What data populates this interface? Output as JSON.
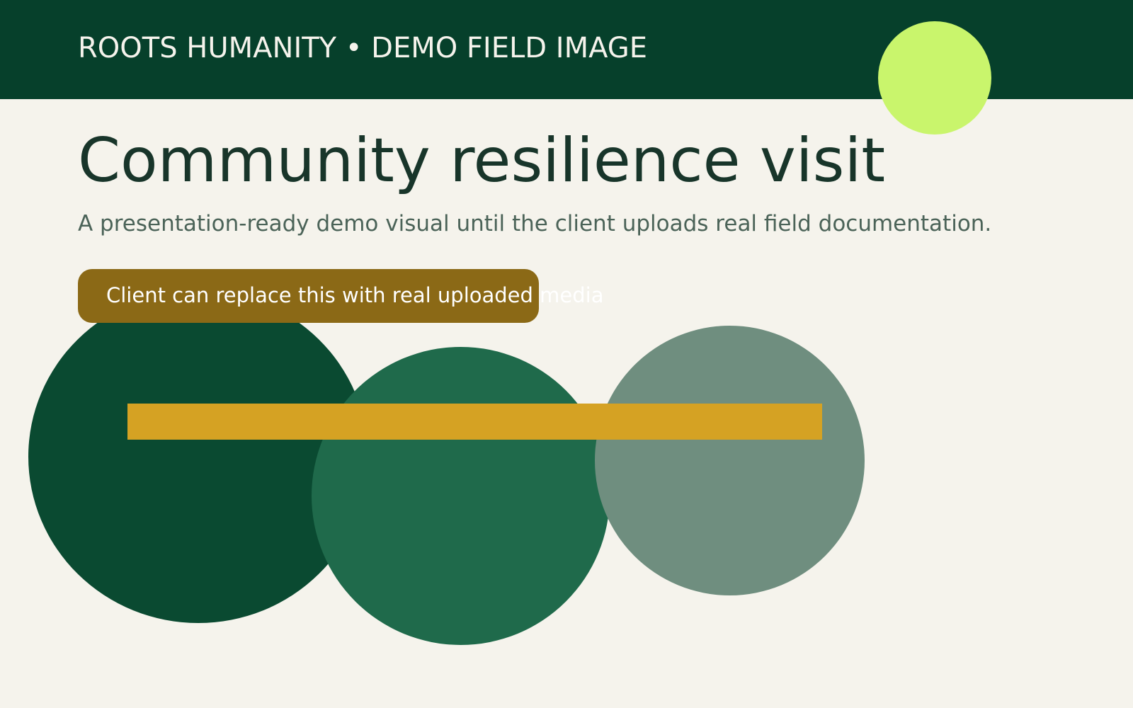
{
  "header": {
    "title": "ROOTS HUMANITY • DEMO FIELD IMAGE"
  },
  "main": {
    "title": "Community resilience visit",
    "subtitle": "A presentation-ready demo visual until the client uploads real field documentation.",
    "badge_text": "Client can replace this with real uploaded media"
  },
  "colors": {
    "header_bg": "#06402b",
    "page_bg": "#f5f3ec",
    "accent_dot": "#c9f56c",
    "badge_bg": "#8b6916",
    "stripe": "#d5a223",
    "circle_dark": "#0a4a31",
    "circle_mid": "#1f6a4b",
    "circle_light": "#6f8e7f"
  }
}
